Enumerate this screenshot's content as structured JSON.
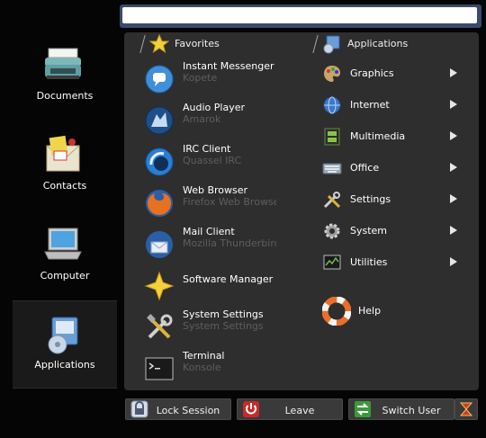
{
  "search": {
    "value": "",
    "placeholder": ""
  },
  "sidebar": {
    "items": [
      {
        "label": "Documents",
        "icon": "typewriter-icon"
      },
      {
        "label": "Contacts",
        "icon": "contacts-icon"
      },
      {
        "label": "Computer",
        "icon": "laptop-icon"
      },
      {
        "label": "Applications",
        "icon": "applications-icon",
        "active": true
      }
    ]
  },
  "favorites": {
    "header": "Favorites",
    "items": [
      {
        "name": "Instant Messenger",
        "sub": "Kopete",
        "icon": "chat-icon"
      },
      {
        "name": "Audio Player",
        "sub": "Amarok",
        "icon": "wolf-icon"
      },
      {
        "name": "IRC Client",
        "sub": "Quassel IRC",
        "icon": "irc-icon"
      },
      {
        "name": "Web Browser",
        "sub": "Firefox Web Browser",
        "icon": "firefox-icon"
      },
      {
        "name": "Mail Client",
        "sub": "Mozilla Thunderbird",
        "icon": "thunderbird-icon"
      },
      {
        "name": "Software Manager",
        "sub": "",
        "icon": "star-icon"
      },
      {
        "name": "System Settings",
        "sub": "System Settings",
        "icon": "tools-icon"
      },
      {
        "name": "Terminal",
        "sub": "Konsole",
        "icon": "terminal-icon"
      }
    ]
  },
  "applications": {
    "header": "Applications",
    "items": [
      {
        "label": "Graphics",
        "icon": "palette-icon",
        "submenu": true
      },
      {
        "label": "Internet",
        "icon": "globe-icon",
        "submenu": true
      },
      {
        "label": "Multimedia",
        "icon": "film-icon",
        "submenu": true
      },
      {
        "label": "Office",
        "icon": "keyboard-icon",
        "submenu": true
      },
      {
        "label": "Settings",
        "icon": "tools-icon",
        "submenu": true
      },
      {
        "label": "System",
        "icon": "gear-icon",
        "submenu": true
      },
      {
        "label": "Utilities",
        "icon": "utilities-icon",
        "submenu": true
      },
      {
        "label": "Help",
        "icon": "lifebuoy-icon",
        "submenu": false
      }
    ]
  },
  "bottom": {
    "lock": "Lock Session",
    "leave": "Leave",
    "switch": "Switch User"
  },
  "colors": {
    "panel": "#2e2e2e",
    "highlight": "#1a1a1a",
    "accent": "#3b4a6b"
  }
}
